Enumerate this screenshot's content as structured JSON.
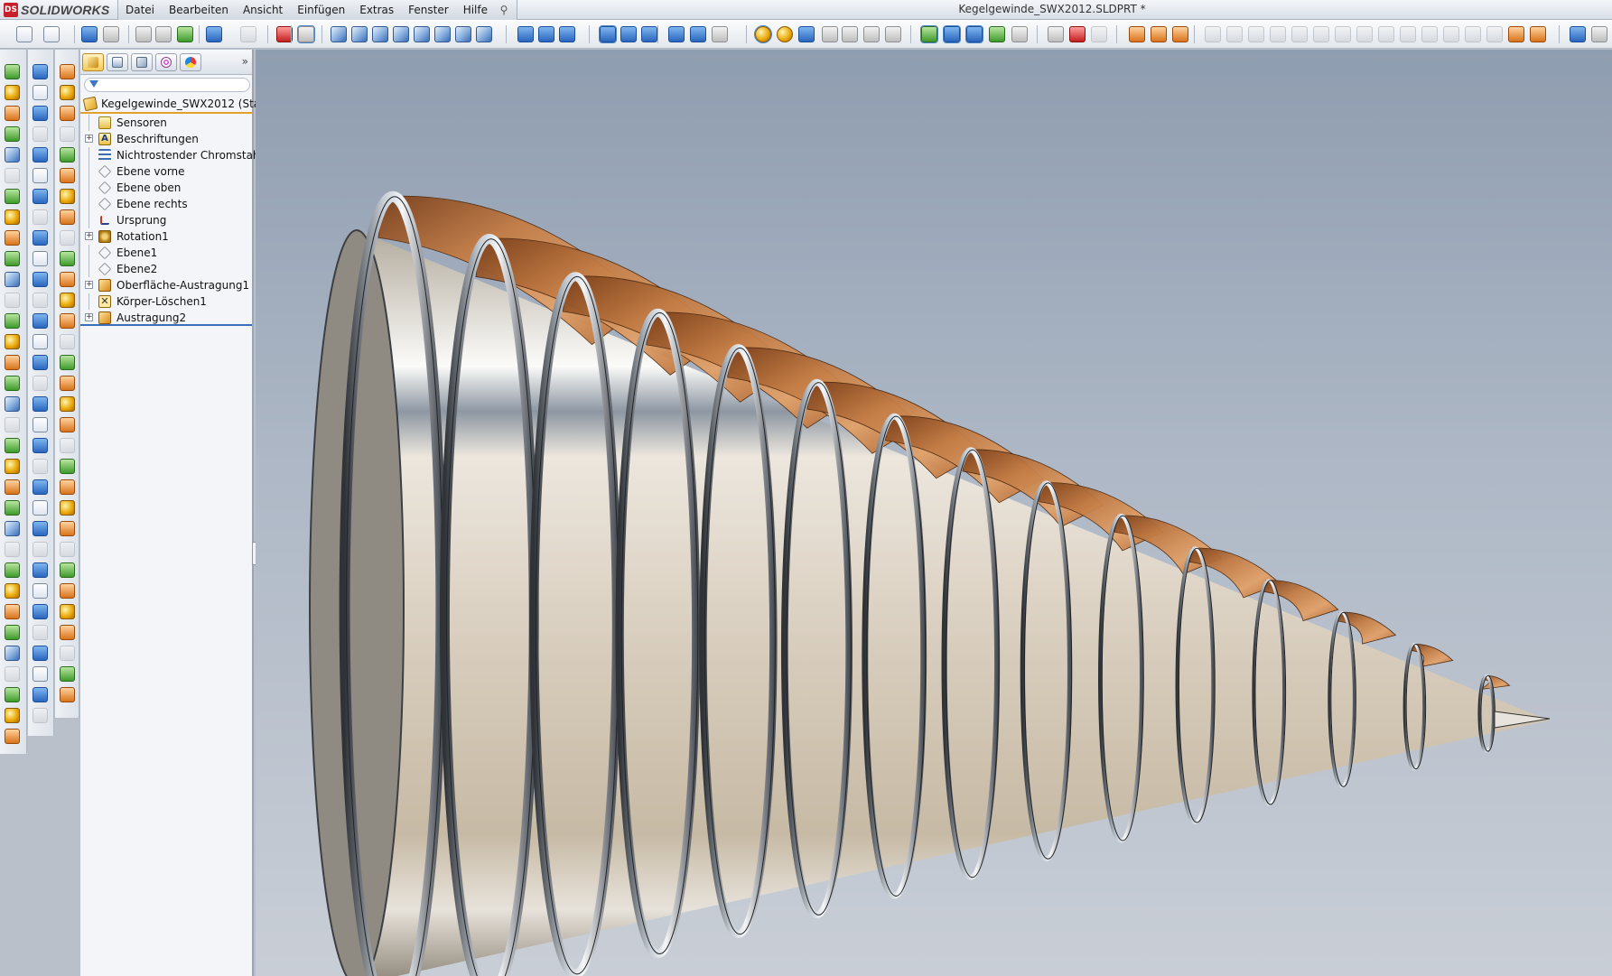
{
  "app": {
    "brand": "SOLIDWORKS",
    "ds_mark": "DS"
  },
  "document": {
    "title": "Kegelgewinde_SWX2012.SLDPRT *"
  },
  "menu": {
    "items": [
      "Datei",
      "Bearbeiten",
      "Ansicht",
      "Einfügen",
      "Extras",
      "Fenster",
      "Hilfe"
    ]
  },
  "feature_manager": {
    "filter_placeholder": "",
    "root": "Kegelgewinde_SWX2012  (Stand",
    "items": [
      {
        "label": "Sensoren",
        "icon": "sensor-icon",
        "expandable": false
      },
      {
        "label": "Beschriftungen",
        "icon": "annotations-icon",
        "expandable": true
      },
      {
        "label": "Nichtrostender Chromstahl",
        "icon": "material-icon",
        "expandable": false
      },
      {
        "label": "Ebene vorne",
        "icon": "plane-icon",
        "expandable": false
      },
      {
        "label": "Ebene oben",
        "icon": "plane-icon",
        "expandable": false
      },
      {
        "label": "Ebene rechts",
        "icon": "plane-icon",
        "expandable": false
      },
      {
        "label": "Ursprung",
        "icon": "origin-icon",
        "expandable": false
      },
      {
        "label": "Rotation1",
        "icon": "revolve-icon",
        "expandable": true
      },
      {
        "label": "Ebene1",
        "icon": "plane-icon",
        "expandable": false
      },
      {
        "label": "Ebene2",
        "icon": "plane-icon",
        "expandable": false
      },
      {
        "label": "Oberfläche-Austragung1",
        "icon": "surface-loft-icon",
        "expandable": true
      },
      {
        "label": "Körper-Löschen1",
        "icon": "delete-body-icon",
        "expandable": false
      },
      {
        "label": "Austragung2",
        "icon": "loft-icon",
        "expandable": true
      }
    ]
  },
  "colors": {
    "viewport_top": "#8f9db0",
    "viewport_bottom": "#c9ced6",
    "thread_copper": "#c9844a",
    "steel": "#cfc6b8"
  }
}
